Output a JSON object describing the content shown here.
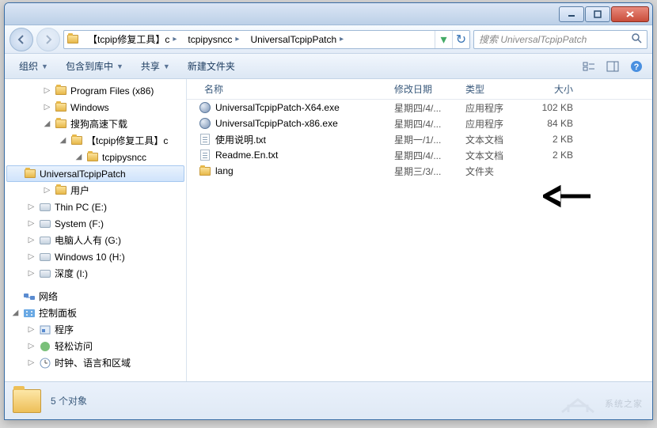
{
  "titlebar": {
    "title": ""
  },
  "nav": {
    "crumbs": [
      "【tcpip修复工具】c",
      "tcpipysncc",
      "UniversalTcpipPatch"
    ],
    "searchPlaceholder": "搜索 UniversalTcpipPatch"
  },
  "toolbar": {
    "organize": "组织",
    "include": "包含到库中",
    "share": "共享",
    "newfolder": "新建文件夹"
  },
  "tree": {
    "nodes": [
      {
        "label": "Program Files (x86)",
        "level": 1,
        "icon": "folder",
        "exp": "▷"
      },
      {
        "label": "Windows",
        "level": 1,
        "icon": "folder",
        "exp": "▷"
      },
      {
        "label": "搜狗高速下载",
        "level": 1,
        "icon": "folder",
        "exp": "◢"
      },
      {
        "label": "【tcpip修复工具】c",
        "level": 2,
        "icon": "folder",
        "exp": "◢"
      },
      {
        "label": "tcpipysncc",
        "level": 3,
        "icon": "folder",
        "exp": "◢"
      },
      {
        "label": "UniversalTcpipPatch",
        "level": 4,
        "icon": "folder",
        "exp": "",
        "sel": true
      },
      {
        "label": "用户",
        "level": 1,
        "icon": "folder",
        "exp": "▷"
      },
      {
        "label": "Thin PC (E:)",
        "level": 0,
        "icon": "drive",
        "exp": "▷"
      },
      {
        "label": "System (F:)",
        "level": 0,
        "icon": "drive",
        "exp": "▷"
      },
      {
        "label": "电脑人人有 (G:)",
        "level": 0,
        "icon": "drive",
        "exp": "▷"
      },
      {
        "label": "Windows 10 (H:)",
        "level": 0,
        "icon": "drive",
        "exp": "▷"
      },
      {
        "label": "深度 (I:)",
        "level": 0,
        "icon": "drive",
        "exp": "▷"
      },
      {
        "label": "网络",
        "level": -1,
        "icon": "net",
        "exp": "",
        "gap": true
      },
      {
        "label": "控制面板",
        "level": -1,
        "icon": "cpanel",
        "exp": "◢"
      },
      {
        "label": "程序",
        "level": 0,
        "icon": "prog",
        "exp": "▷"
      },
      {
        "label": "轻松访问",
        "level": 0,
        "icon": "ease",
        "exp": "▷"
      },
      {
        "label": "时钟、语言和区域",
        "level": 0,
        "icon": "clock",
        "exp": "▷"
      }
    ]
  },
  "columns": {
    "name": "名称",
    "date": "修改日期",
    "type": "类型",
    "size": "大小"
  },
  "files": [
    {
      "name": "UniversalTcpipPatch-X64.exe",
      "date": "星期四/4/...",
      "type": "应用程序",
      "size": "102 KB",
      "icon": "exe"
    },
    {
      "name": "UniversalTcpipPatch-x86.exe",
      "date": "星期四/4/...",
      "type": "应用程序",
      "size": "84 KB",
      "icon": "exe"
    },
    {
      "name": "使用说明.txt",
      "date": "星期一/1/...",
      "type": "文本文档",
      "size": "2 KB",
      "icon": "txt"
    },
    {
      "name": "Readme.En.txt",
      "date": "星期四/4/...",
      "type": "文本文档",
      "size": "2 KB",
      "icon": "txt"
    },
    {
      "name": "lang",
      "date": "星期三/3/...",
      "type": "文件夹",
      "size": "",
      "icon": "folder"
    }
  ],
  "status": {
    "count": "5 个对象"
  },
  "watermark": "系统之家"
}
